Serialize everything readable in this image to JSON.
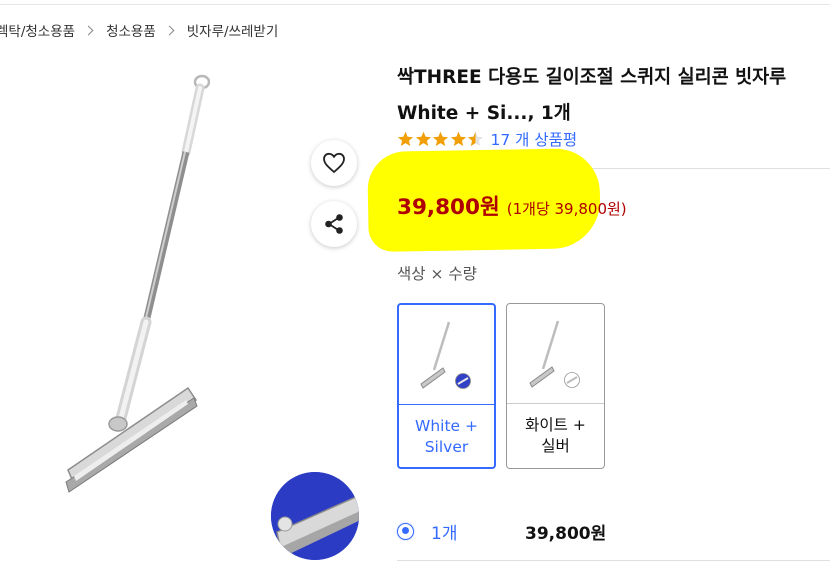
{
  "breadcrumb": {
    "items": [
      "렉탁/청소용품",
      "청소용품",
      "빗자루/쓰레받기"
    ]
  },
  "product": {
    "title_line1": "싹THREE 다용도 길이조절 스퀴지 실리콘 빗자루",
    "title_line2": "White + Si..., 1개",
    "rating": 4.5,
    "review_text": "17 개 상품평",
    "price": "39,800원",
    "unit_price": "(1개당 39,800원)"
  },
  "options": {
    "label": "색상 × 수량",
    "cards": [
      {
        "label": "White +\nSilver",
        "selected": true,
        "swatch": "#3142c9"
      },
      {
        "label": "화이트 +\n실버",
        "selected": false,
        "swatch": "#ffffff"
      }
    ]
  },
  "quantity": {
    "label": "1개",
    "price": "39,800원"
  },
  "icons": {
    "heart": "heart-icon",
    "share": "share-icon",
    "star": "star-icon",
    "chevron": "chevron-right-icon"
  },
  "colors": {
    "accent_blue": "#346aff",
    "price_red": "#ae0000",
    "star_orange": "#f29f05",
    "highlight": "#ffff00"
  }
}
